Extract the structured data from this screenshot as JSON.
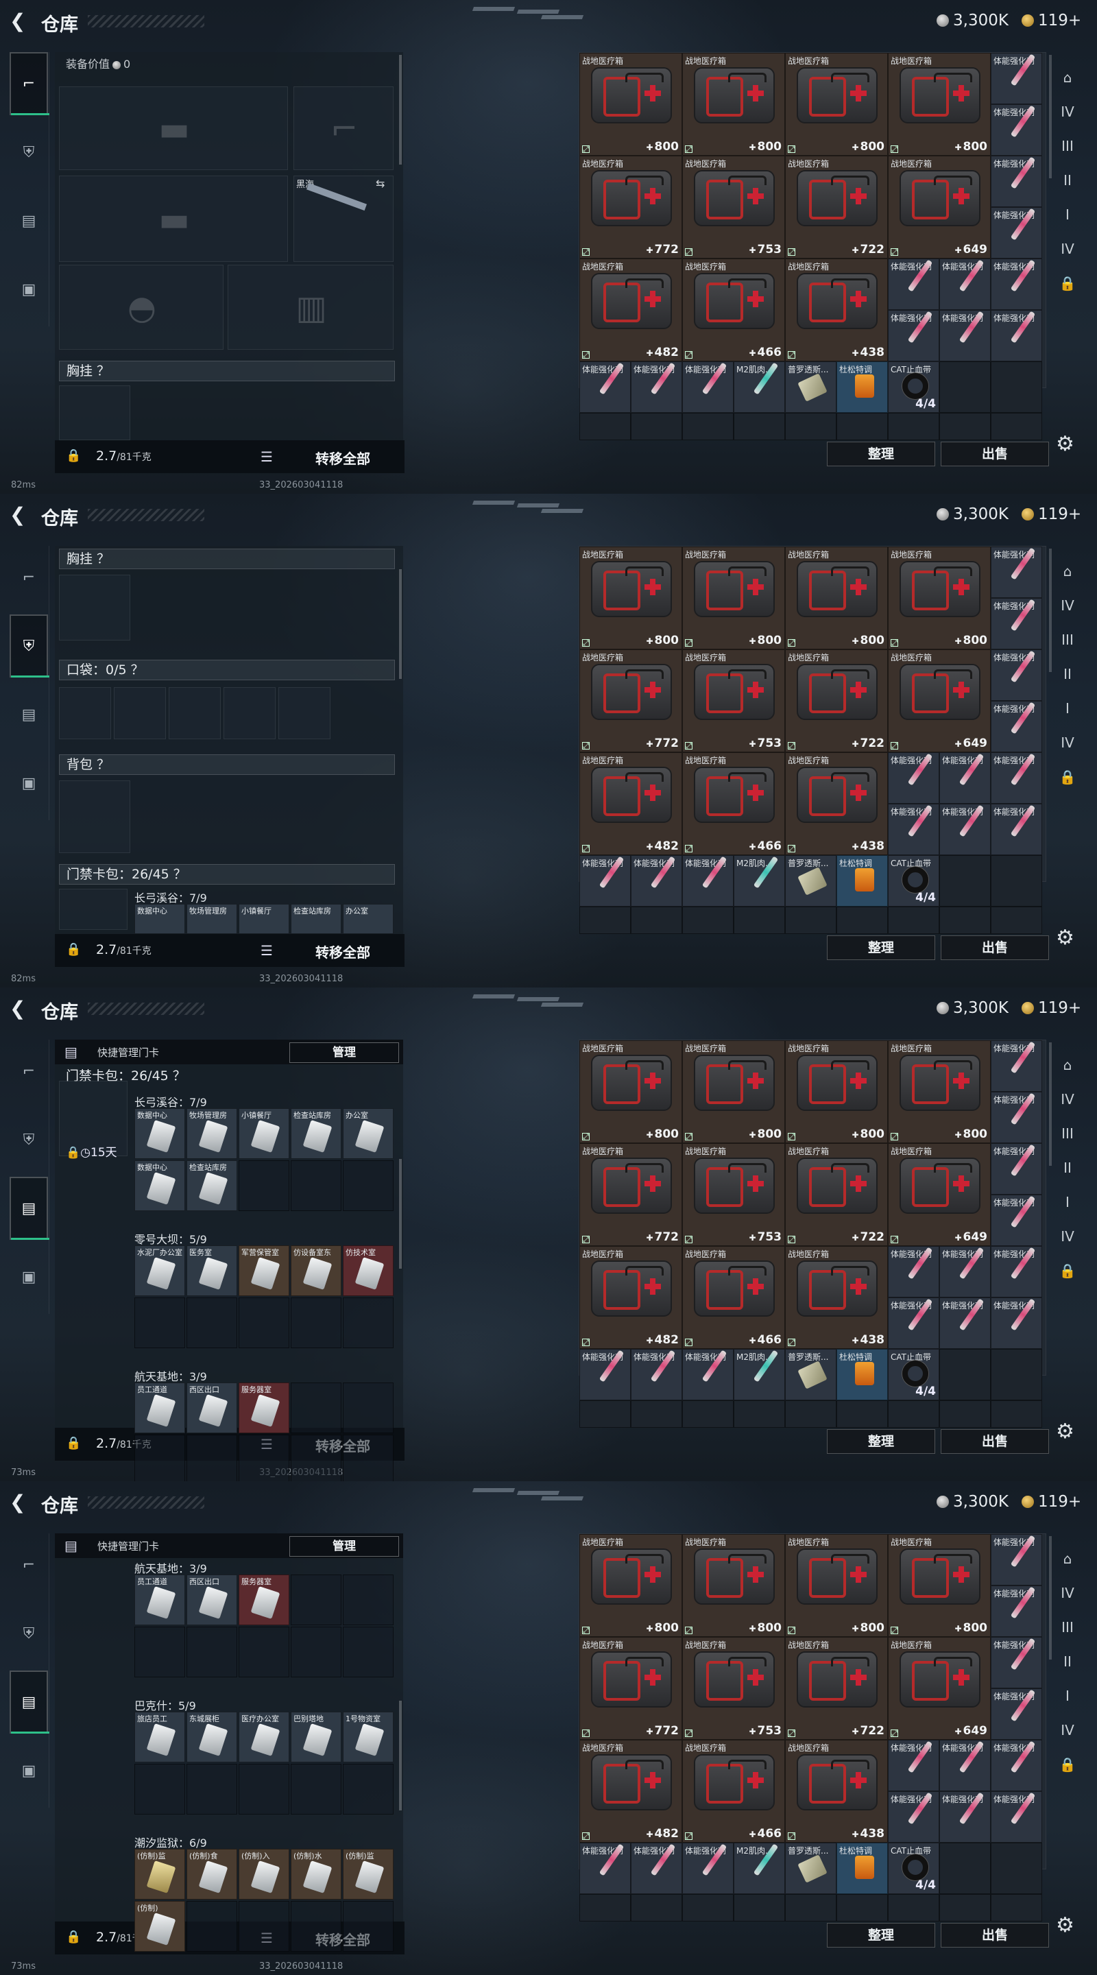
{
  "header": {
    "title": "仓库",
    "silver": "3,300K",
    "gold": "119+"
  },
  "bottom": {
    "weight": "2.7",
    "weight_max": "/81千克",
    "transfer": "转移全部",
    "sort": "整理",
    "sell": "出售"
  },
  "status": {
    "build": "33_202603041118",
    "pings": [
      "82ms",
      "82ms",
      "73ms",
      "73ms"
    ]
  },
  "screen1": {
    "equip_value_label": "装备价值",
    "equip_value": "0",
    "weapon_name": "黑海",
    "chest_label": "胸挂 ？"
  },
  "screen2": {
    "chest_label": "胸挂 ？",
    "pocket_label": "口袋：0/5 ？",
    "backpack_label": "背包 ？",
    "keycard_label": "门禁卡包：26/45 ？",
    "chang_label": "长弓溪谷：7/9",
    "chang_cards": [
      "数据中心",
      "牧场管理房",
      "小镇餐厅",
      "检查站库房",
      "办公室"
    ]
  },
  "keycard_panel": {
    "header": "快捷管理门卡",
    "manage": "管理",
    "bag_label": "门禁卡包：26/45 ？",
    "days": "15天"
  },
  "groups3": [
    {
      "name": "长弓溪谷：7/9",
      "cards": [
        "数据中心",
        "牧场管理房",
        "小镇餐厅",
        "检查站库房",
        "办公室",
        "数据中心",
        "检查站库房"
      ]
    },
    {
      "name": "零号大坝：5/9",
      "cards": [
        "水泥厂办公室",
        "医务室",
        "军营保管室",
        "仿设备室东",
        "仿技术室"
      ]
    },
    {
      "name": "航天基地：3/9",
      "cards": [
        "员工通道",
        "西区出口",
        "服务器室"
      ]
    }
  ],
  "groups4": [
    {
      "name": "航天基地：3/9",
      "cards": [
        "员工通道",
        "西区出口",
        "服务器室"
      ]
    },
    {
      "name": "巴克什：5/9",
      "cards": [
        "旅店员工",
        "东城展柜",
        "医疗办公室",
        "巴别塔地",
        "1号物资室"
      ]
    },
    {
      "name": "潮汐监狱：6/9",
      "cards": [
        "(仿制)监",
        "(仿制)食",
        "(仿制)入",
        "(仿制)水",
        "(仿制)监",
        "(仿制)"
      ]
    }
  ],
  "inventory": {
    "med_name": "战地医疗箱",
    "rows": [
      [
        "800",
        "800",
        "800",
        "800"
      ],
      [
        "772",
        "753",
        "722",
        "649"
      ],
      [
        "482",
        "466",
        "438"
      ]
    ],
    "syringe_name": "体能强化剂",
    "small_row": [
      "体能强化剂",
      "体能强化剂",
      "体能强化剂",
      "M2肌肉...",
      "普罗透斯...",
      "杜松特调",
      "CAT止血带"
    ],
    "cat_count": "4/4"
  }
}
